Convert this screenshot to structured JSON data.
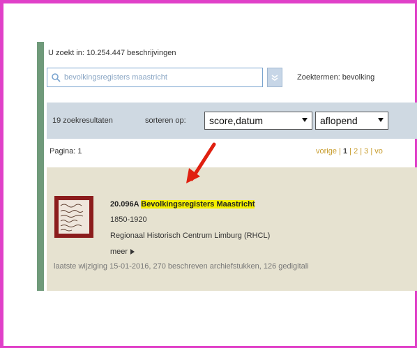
{
  "search": {
    "count_text": "U zoekt in: 10.254.447 beschrijvingen",
    "query": "bevolkingsregisters maastricht",
    "terms_text": "Zoektermen: bevolking"
  },
  "results_bar": {
    "count_text": "19 zoekresultaten",
    "sort_label": "sorteren op:",
    "sort_value": "score,datum",
    "order_value": "aflopend"
  },
  "paging": {
    "label": "Pagina: 1",
    "prev": "vorige",
    "sep1": " | ",
    "current": "1",
    "sep2": " | ",
    "p2": "2",
    "sep3": " | ",
    "p3": "3",
    "sep4": " | ",
    "next_partial": "vo"
  },
  "result": {
    "code": "20.096A",
    "title": "Bevolkingsregisters Maastricht",
    "years": "1850-1920",
    "organization": "Regionaal Historisch Centrum Limburg (RHCL)",
    "more": "meer",
    "modified": "laatste wijziging 15-01-2016,  270 beschreven archiefstukken,  126 gedigitali"
  },
  "colors": {
    "frame": "#e040c8",
    "side_bar": "#6f9a7a",
    "highlight": "#f5f000",
    "arrow": "#e02010",
    "pager_link": "#c79b2a"
  }
}
